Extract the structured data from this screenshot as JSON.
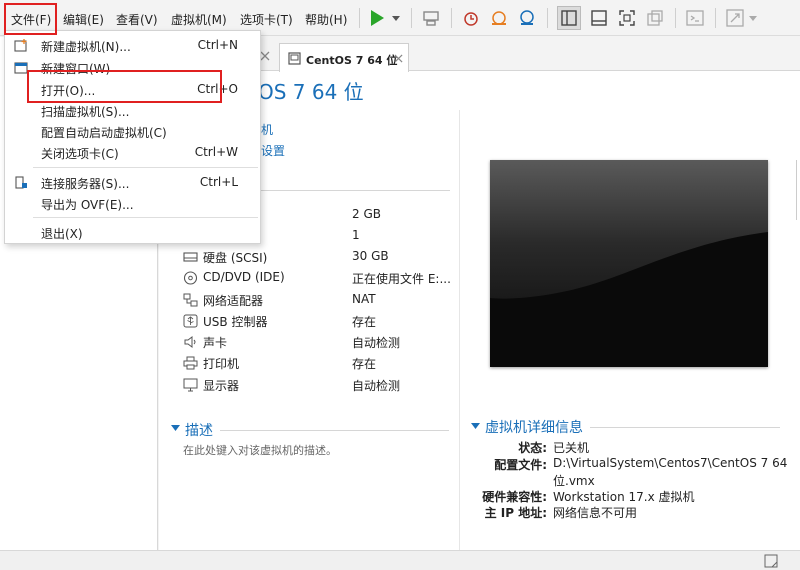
{
  "menubar": {
    "items": [
      {
        "label": "文件(F)"
      },
      {
        "label": "编辑(E)"
      },
      {
        "label": "查看(V)"
      },
      {
        "label": "虚拟机(M)"
      },
      {
        "label": "选项卡(T)"
      },
      {
        "label": "帮助(H)"
      }
    ]
  },
  "file_menu": {
    "items": [
      {
        "label": "新建虚拟机(N)...",
        "shortcut": "Ctrl+N",
        "icon": "new-vm-icon"
      },
      {
        "label": "新建窗口(W)",
        "shortcut": "",
        "icon": "new-window-icon"
      },
      {
        "label": "打开(O)...",
        "shortcut": "Ctrl+O",
        "icon": ""
      },
      {
        "label": "扫描虚拟机(S)...",
        "shortcut": "",
        "icon": ""
      },
      {
        "label": "配置自动启动虚拟机(C)",
        "shortcut": "",
        "icon": ""
      },
      {
        "label": "关闭选项卡(C)",
        "shortcut": "Ctrl+W",
        "icon": ""
      },
      {
        "label": "连接服务器(S)...",
        "shortcut": "Ctrl+L",
        "icon": "connect-server-icon"
      },
      {
        "label": "导出为 OVF(E)...",
        "shortcut": "",
        "icon": ""
      },
      {
        "label": "退出(X)",
        "shortcut": "",
        "icon": ""
      }
    ]
  },
  "tab": {
    "label": "CentOS 7 64 位"
  },
  "vm": {
    "title": "OS 7 64 位",
    "actions": [
      "机",
      "设置"
    ],
    "devices": [
      {
        "name": "",
        "value": "2 GB",
        "icon": ""
      },
      {
        "name": "",
        "value": "1",
        "icon": ""
      },
      {
        "name": "硬盘 (SCSI)",
        "value": "30 GB",
        "icon": "hard-disk-icon"
      },
      {
        "name": "CD/DVD (IDE)",
        "value": "正在使用文件 E:...",
        "icon": "cd-dvd-icon"
      },
      {
        "name": "网络适配器",
        "value": "NAT",
        "icon": "network-adapter-icon"
      },
      {
        "name": "USB 控制器",
        "value": "存在",
        "icon": "usb-icon"
      },
      {
        "name": "声卡",
        "value": "自动检测",
        "icon": "sound-card-icon"
      },
      {
        "name": "打印机",
        "value": "存在",
        "icon": "printer-icon"
      },
      {
        "name": "显示器",
        "value": "自动检测",
        "icon": "display-icon"
      }
    ],
    "description": {
      "heading": "描述",
      "placeholder": "在此处键入对该虚拟机的描述。"
    },
    "details": {
      "heading": "虚拟机详细信息",
      "rows": [
        {
          "label": "状态:",
          "value": "已关机"
        },
        {
          "label": "配置文件:",
          "value": "D:\\VirtualSystem\\Centos7\\CentOS 7 64"
        },
        {
          "label": "",
          "value": "位.vmx"
        },
        {
          "label": "硬件兼容性:",
          "value": "Workstation 17.x 虚拟机"
        },
        {
          "label": "主 IP 地址:",
          "value": "网络信息不可用"
        }
      ]
    }
  },
  "colors": {
    "accent": "#1a6fb8",
    "highlight": "#e02020",
    "play": "#2aa52a"
  }
}
